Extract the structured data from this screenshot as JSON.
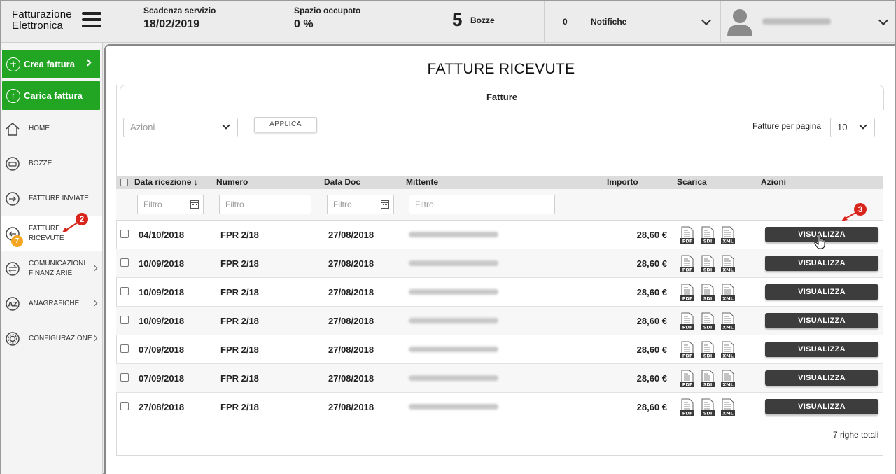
{
  "header": {
    "logo_line1": "Fatturazione",
    "logo_line2": "Elettronica",
    "scadenza_label": "Scadenza servizio",
    "scadenza_value": "18/02/2019",
    "spazio_label": "Spazio occupato",
    "spazio_value": "0 %",
    "bozze_count": "5",
    "bozze_label": "Bozze",
    "notifiche_count": "0",
    "notifiche_label": "Notifiche"
  },
  "sidebar": {
    "crea_label": "Crea fattura",
    "carica_label": "Carica fattura",
    "items": [
      {
        "label": "HOME"
      },
      {
        "label": "BOZZE"
      },
      {
        "label": "FATTURE INVIATE"
      },
      {
        "label_line1": "FATTURE",
        "label_line2": "RICEVUTE",
        "badge": "7"
      },
      {
        "label_line1": "COMUNICAZIONI",
        "label_line2": "FINANZIARIE"
      },
      {
        "label": "ANAGRAFICHE"
      },
      {
        "label": "CONFIGURAZIONE"
      }
    ]
  },
  "main": {
    "title": "FATTURE RICEVUTE",
    "tab_label": "Fatture",
    "azioni_placeholder": "Azioni",
    "apply_label": "APPLICA",
    "perpage_label": "Fatture per pagina",
    "perpage_value": "10",
    "columns": {
      "data_ricezione": "Data ricezione",
      "sort_arrow": "↓",
      "numero": "Numero",
      "data_doc": "Data Doc",
      "mittente": "Mittente",
      "importo": "Importo",
      "scarica": "Scarica",
      "azioni": "Azioni"
    },
    "filter_placeholder": "Filtro",
    "rows": [
      {
        "data_ricezione": "04/10/2018",
        "numero": "FPR 2/18",
        "data_doc": "27/08/2018",
        "importo": "28,60 €"
      },
      {
        "data_ricezione": "10/09/2018",
        "numero": "FPR 2/18",
        "data_doc": "27/08/2018",
        "importo": "28,60 €"
      },
      {
        "data_ricezione": "10/09/2018",
        "numero": "FPR 2/18",
        "data_doc": "27/08/2018",
        "importo": "28,60 €"
      },
      {
        "data_ricezione": "10/09/2018",
        "numero": "FPR 2/18",
        "data_doc": "27/08/2018",
        "importo": "28,60 €"
      },
      {
        "data_ricezione": "07/09/2018",
        "numero": "FPR 2/18",
        "data_doc": "27/08/2018",
        "importo": "28,60 €"
      },
      {
        "data_ricezione": "07/09/2018",
        "numero": "FPR 2/18",
        "data_doc": "27/08/2018",
        "importo": "28,60 €"
      },
      {
        "data_ricezione": "27/08/2018",
        "numero": "FPR 2/18",
        "data_doc": "27/08/2018",
        "importo": "28,60 €"
      }
    ],
    "file_labels": {
      "pdf": "PDF",
      "sdi": "SDI",
      "xml": "XML"
    },
    "view_label": "VISUALIZZA",
    "total_label": "7 righe totali"
  },
  "annotations": {
    "marker_2": "2",
    "marker_3": "3"
  },
  "colors": {
    "green": "#22a522",
    "dark_button": "#3d3d3d",
    "badge": "#f5a623",
    "marker": "#d9261c"
  }
}
